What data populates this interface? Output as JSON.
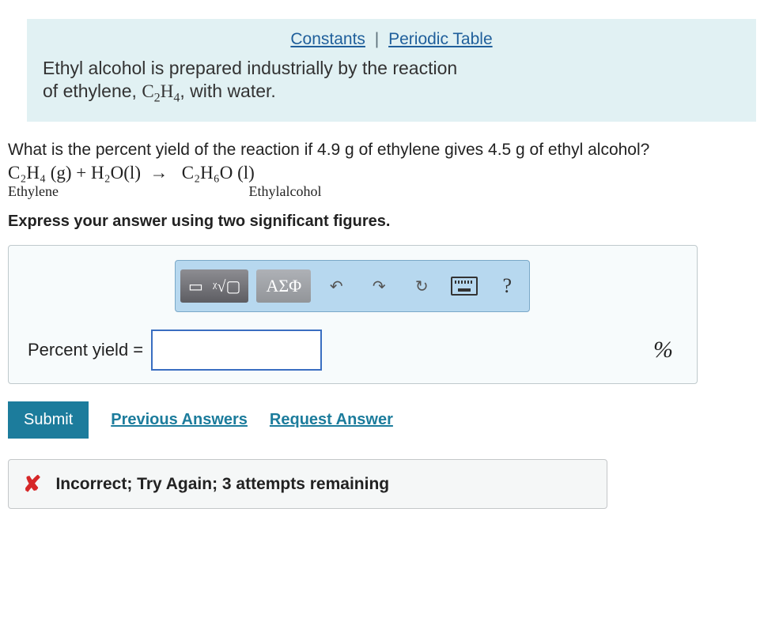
{
  "refs": {
    "constants": "Constants",
    "periodic": "Periodic Table"
  },
  "intro": {
    "line1": "Ethyl alcohol is prepared industrially by the reaction",
    "line2a": "of ethylene, ",
    "formula_c": "C",
    "formula_2": "2",
    "formula_h": "H",
    "formula_4": "4",
    "line2b": ", with water."
  },
  "question": "What is the percent yield of the reaction if 4.9 g of ethylene gives 4.5 g of ethyl alcohol?",
  "equation": {
    "lhs": "C₂H₄ (g) + H₂O(l)",
    "arrow": "→",
    "rhs": "C₂H₆O (l)",
    "label_lhs": "Ethylene",
    "label_rhs": "Ethylalcohol"
  },
  "instruction": "Express your answer using two significant figures.",
  "toolbar": {
    "template_icon": "▭",
    "root_icon": "ᵡ√▢",
    "greek": "ΑΣΦ",
    "undo": "↶",
    "redo": "↷",
    "reset": "↻",
    "keyboard": "⌨",
    "help": "?"
  },
  "answer": {
    "label": "Percent yield =",
    "value": "",
    "unit": "%"
  },
  "actions": {
    "submit": "Submit",
    "previous": "Previous Answers",
    "request": "Request Answer"
  },
  "feedback": {
    "icon": "✘",
    "text": "Incorrect; Try Again; 3 attempts remaining"
  },
  "chart_data": {
    "type": "table",
    "title": "Percent yield problem",
    "reactant": "ethylene (C2H4)",
    "product": "ethyl alcohol (C2H6O)",
    "mass_reactant_g": 4.9,
    "mass_product_g": 4.5,
    "sig_figs": 2
  }
}
